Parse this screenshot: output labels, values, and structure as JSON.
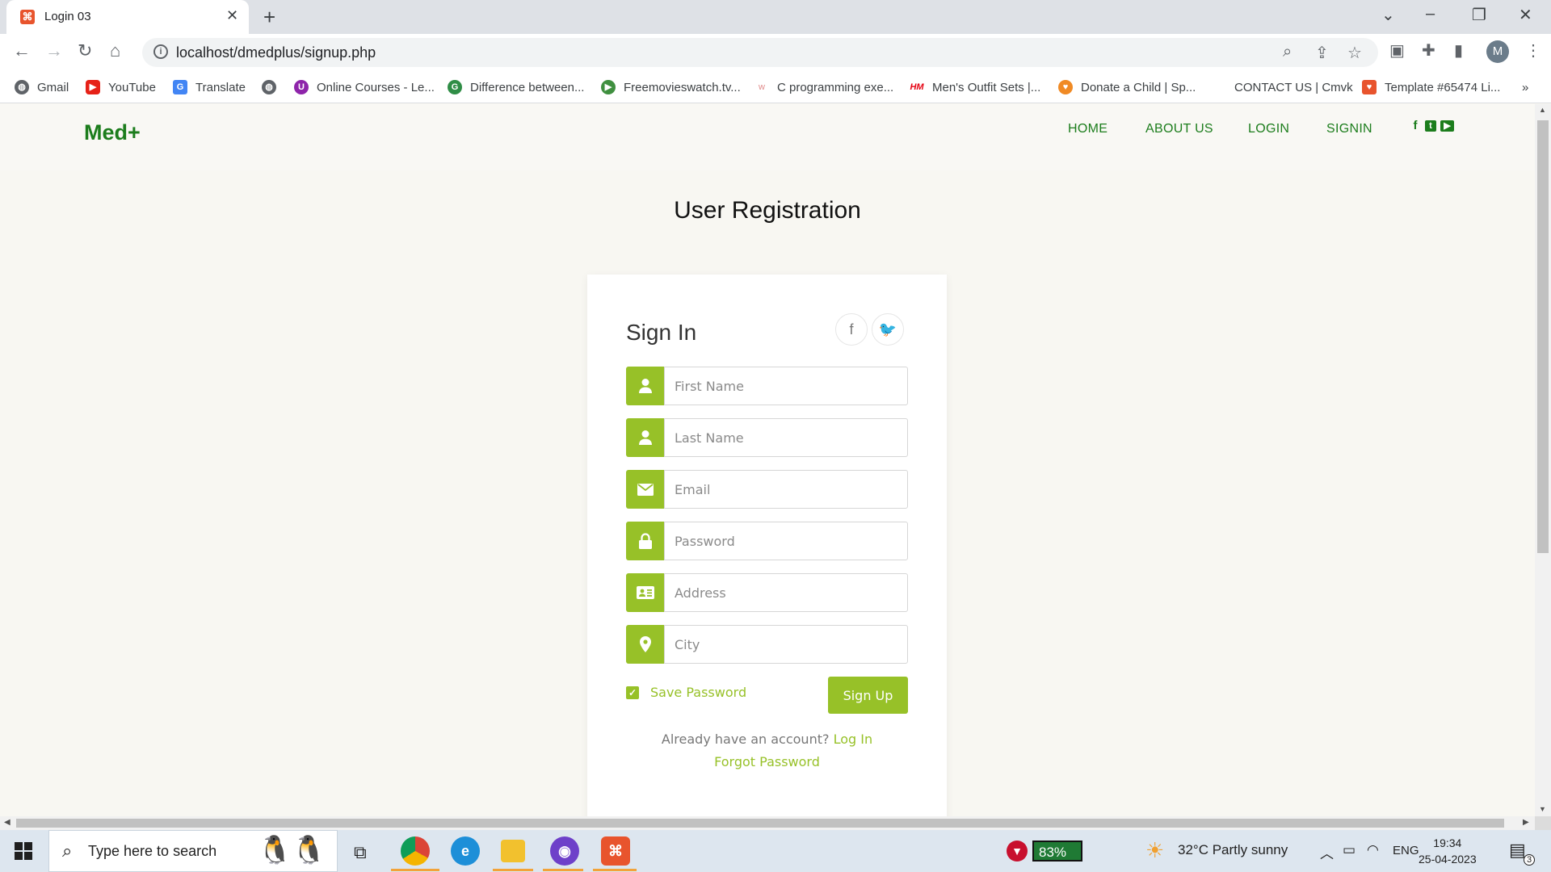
{
  "browser": {
    "tab_title": "Login 03",
    "url": "localhost/dmedplus/signup.php",
    "profile_initial": "M",
    "bookmarks": [
      {
        "label": "Gmail",
        "icon": "gmail-icon"
      },
      {
        "label": "YouTube",
        "icon": "youtube-icon"
      },
      {
        "label": "Translate",
        "icon": "translate-icon"
      },
      {
        "label": "",
        "icon": "globe-icon"
      },
      {
        "label": "Online Courses - Le...",
        "icon": "courses-icon"
      },
      {
        "label": "Difference between...",
        "icon": "gfg-icon"
      },
      {
        "label": "Freemovieswatch.tv...",
        "icon": "play-icon"
      },
      {
        "label": "C programming exe...",
        "icon": "w3r-icon"
      },
      {
        "label": "Men's Outfit Sets |...",
        "icon": "hm-icon"
      },
      {
        "label": "Donate a Child | Sp...",
        "icon": "donate-icon"
      },
      {
        "label": "CONTACT US | Cmvk",
        "icon": ""
      },
      {
        "label": "Template #65474 Li...",
        "icon": "template-icon"
      }
    ],
    "more_bookmarks": "»"
  },
  "site": {
    "logo": "Med+",
    "nav": [
      "HOME",
      "ABOUT US",
      "LOGIN",
      "SIGNIN"
    ],
    "social_icons": [
      "facebook-icon",
      "twitter-icon",
      "youtube-icon"
    ]
  },
  "page": {
    "title": "User Registration"
  },
  "form": {
    "heading": "Sign In",
    "fields": [
      {
        "placeholder": "First Name",
        "icon": "user-icon"
      },
      {
        "placeholder": "Last Name",
        "icon": "user-icon"
      },
      {
        "placeholder": "Email",
        "icon": "envelope-icon"
      },
      {
        "placeholder": "Password",
        "icon": "lock-icon"
      },
      {
        "placeholder": "Address",
        "icon": "address-card-icon"
      },
      {
        "placeholder": "City",
        "icon": "map-marker-icon"
      }
    ],
    "save_password_label": "Save Password",
    "save_password_checked": true,
    "submit_label": "Sign Up",
    "already_text": "Already have an account?",
    "login_link": "Log In",
    "forgot_link": "Forgot Password",
    "accent_color": "#97c128"
  },
  "taskbar": {
    "search_placeholder": "Type here to search",
    "battery_widget": "83%",
    "weather": "32°C  Partly sunny",
    "language": "ENG",
    "time": "19:34",
    "date": "25-04-2023",
    "notification_count": "3"
  }
}
